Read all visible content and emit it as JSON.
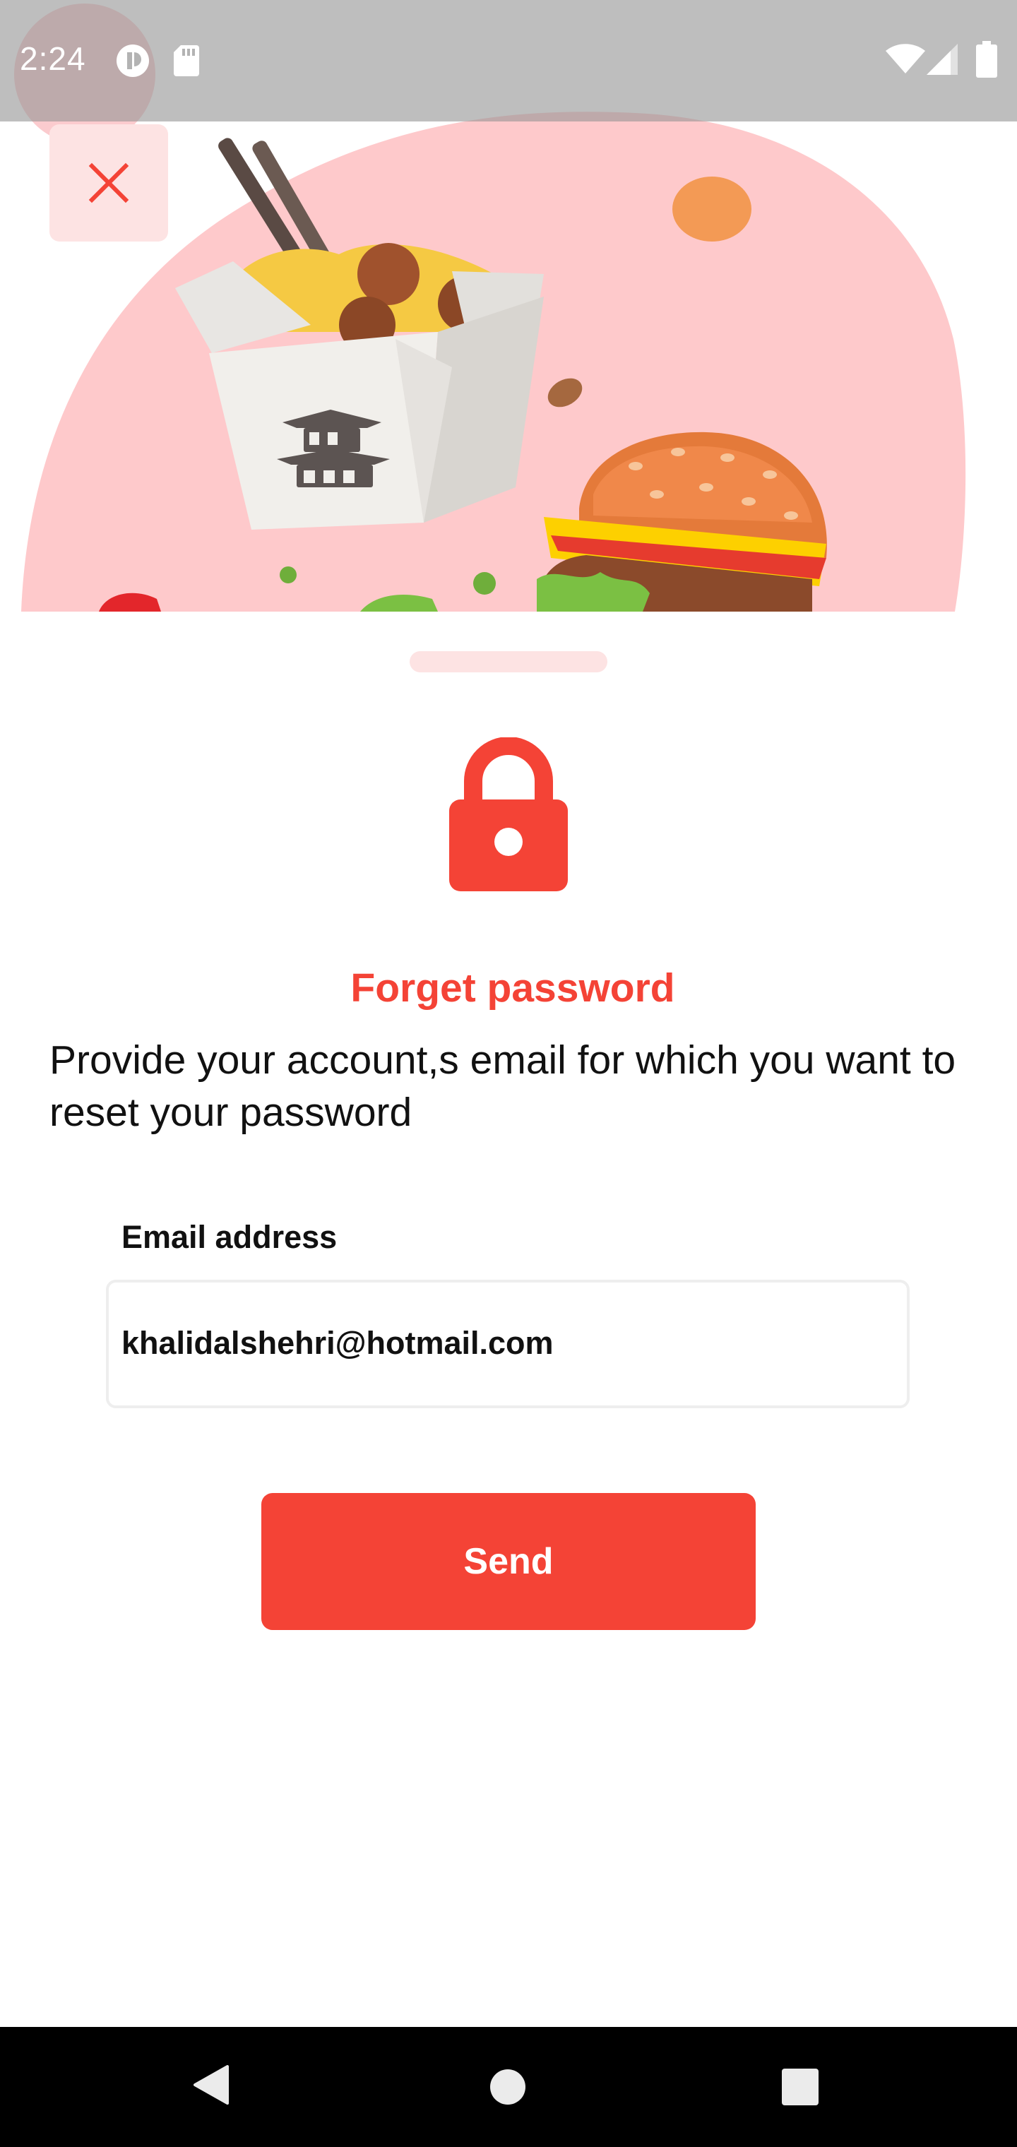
{
  "status_bar": {
    "time": "2:24"
  },
  "header": {
    "close_icon": "close-icon"
  },
  "main": {
    "icon": "lock-icon",
    "title": "Forget password",
    "instruction": "Provide your account,s email for which you want to reset your password",
    "email_label": "Email address",
    "email_value": "khalidalshehri@hotmail.com",
    "send_label": "Send"
  },
  "nav_bar": {
    "back": "back-triangle-icon",
    "home": "home-circle-icon",
    "recents": "recents-square-icon"
  },
  "colors": {
    "accent": "#f44336",
    "accent_light": "#fde3e3",
    "hero_blob": "#fec9cb"
  }
}
